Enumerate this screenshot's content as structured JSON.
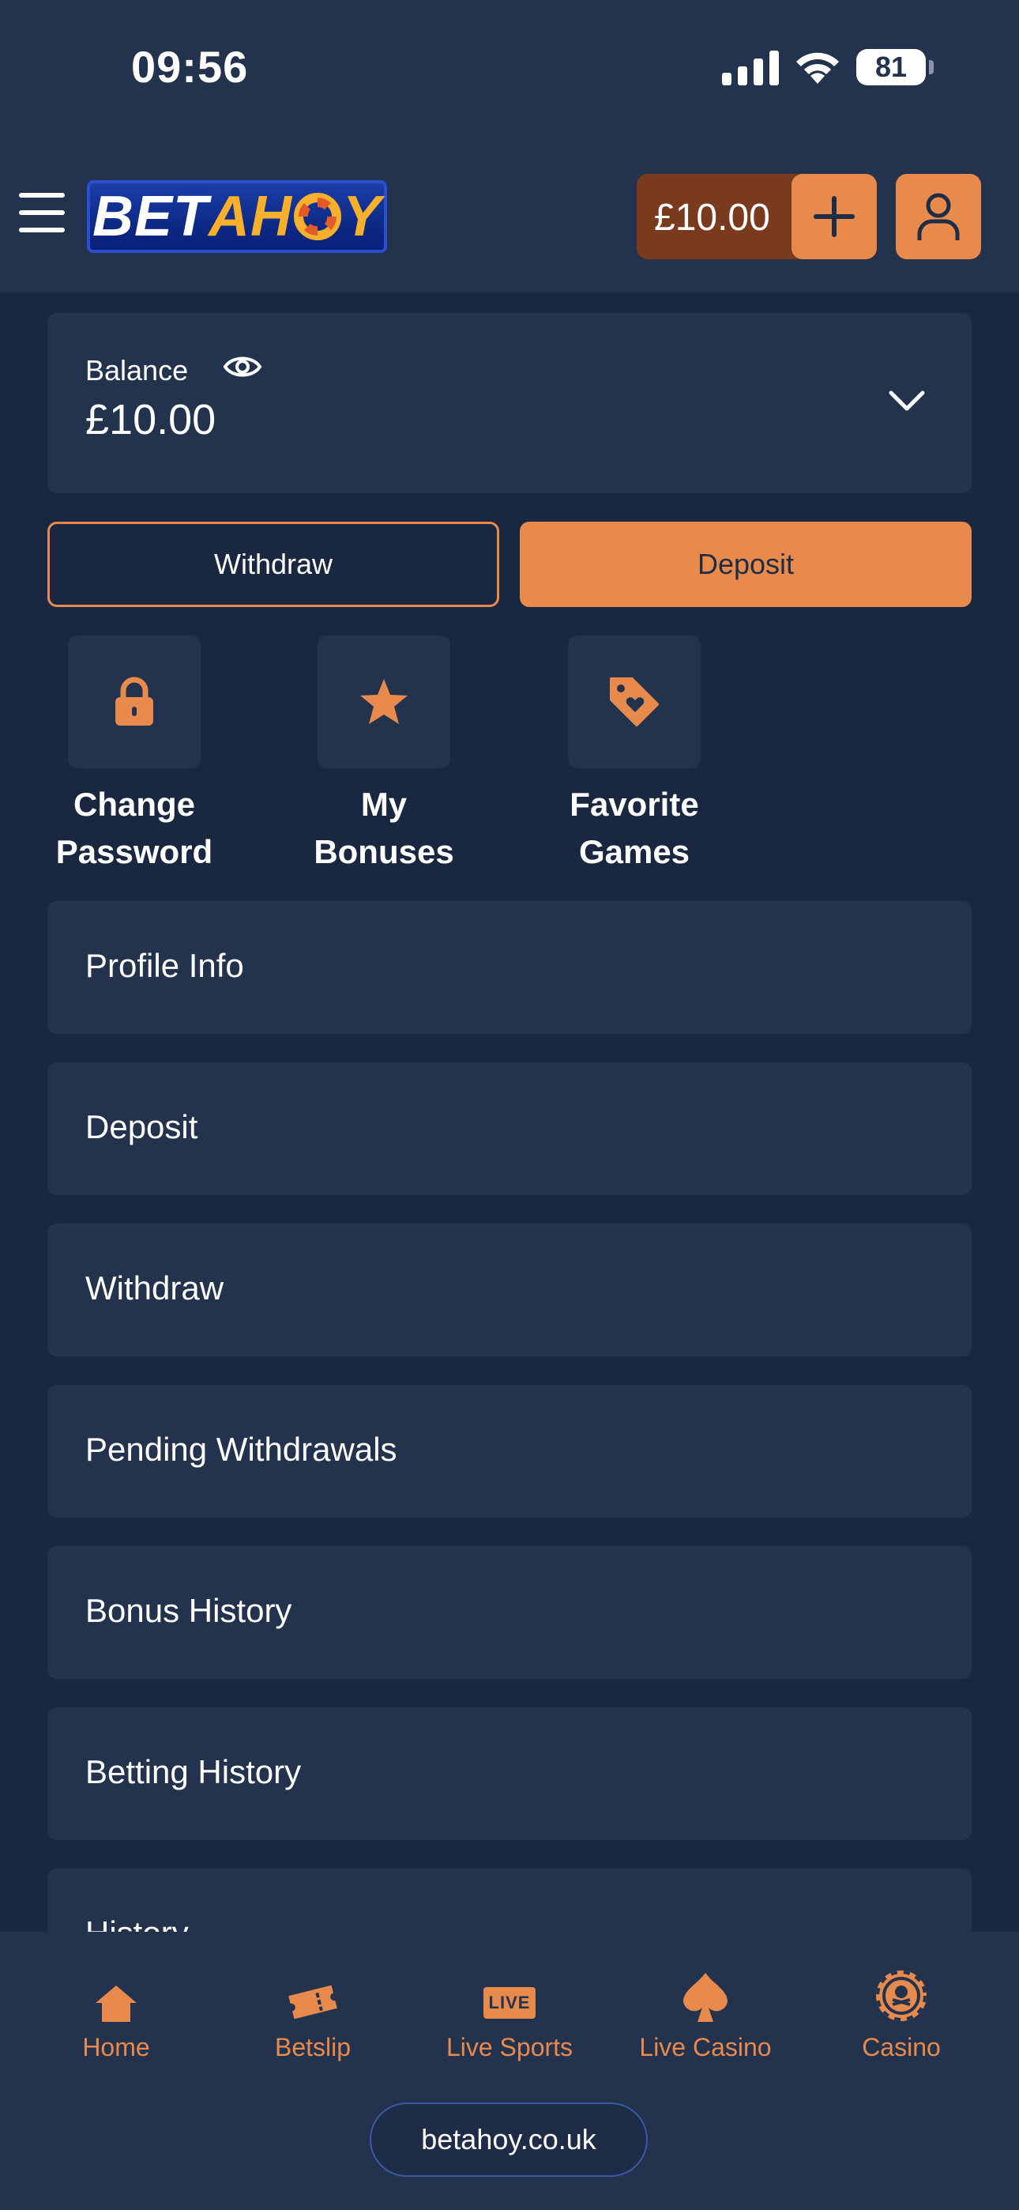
{
  "status_bar": {
    "time": "09:56",
    "battery": "81"
  },
  "header": {
    "logo": {
      "part1": "BET",
      "part2": "AH",
      "part3": "Y"
    },
    "balance": "£10.00"
  },
  "balance_card": {
    "label": "Balance",
    "value": "£10.00"
  },
  "actions": {
    "withdraw": "Withdraw",
    "deposit": "Deposit"
  },
  "quick_actions": [
    {
      "label": "Change\nPassword",
      "icon": "lock-icon"
    },
    {
      "label": "My\nBonuses",
      "icon": "star-icon"
    },
    {
      "label": "Favorite\nGames",
      "icon": "tag-heart-icon"
    }
  ],
  "menu": [
    {
      "label": "Profile Info"
    },
    {
      "label": "Deposit"
    },
    {
      "label": "Withdraw"
    },
    {
      "label": "Pending Withdrawals"
    },
    {
      "label": "Bonus History"
    },
    {
      "label": "Betting History"
    },
    {
      "label": "History"
    }
  ],
  "bottom_nav": [
    {
      "label": "Home",
      "icon": "home-icon"
    },
    {
      "label": "Betslip",
      "icon": "ticket-icon"
    },
    {
      "label": "Live Sports",
      "icon": "live-icon",
      "badge": "LIVE"
    },
    {
      "label": "Live Casino",
      "icon": "spade-icon"
    },
    {
      "label": "Casino",
      "icon": "chip-icon"
    }
  ],
  "domain": "betahoy.co.uk",
  "colors": {
    "accent": "#e98a4d",
    "background": "#1a2740",
    "card": "#24334d",
    "brand_blue": "#0d2a86",
    "brand_gold": "#f7b02c"
  }
}
